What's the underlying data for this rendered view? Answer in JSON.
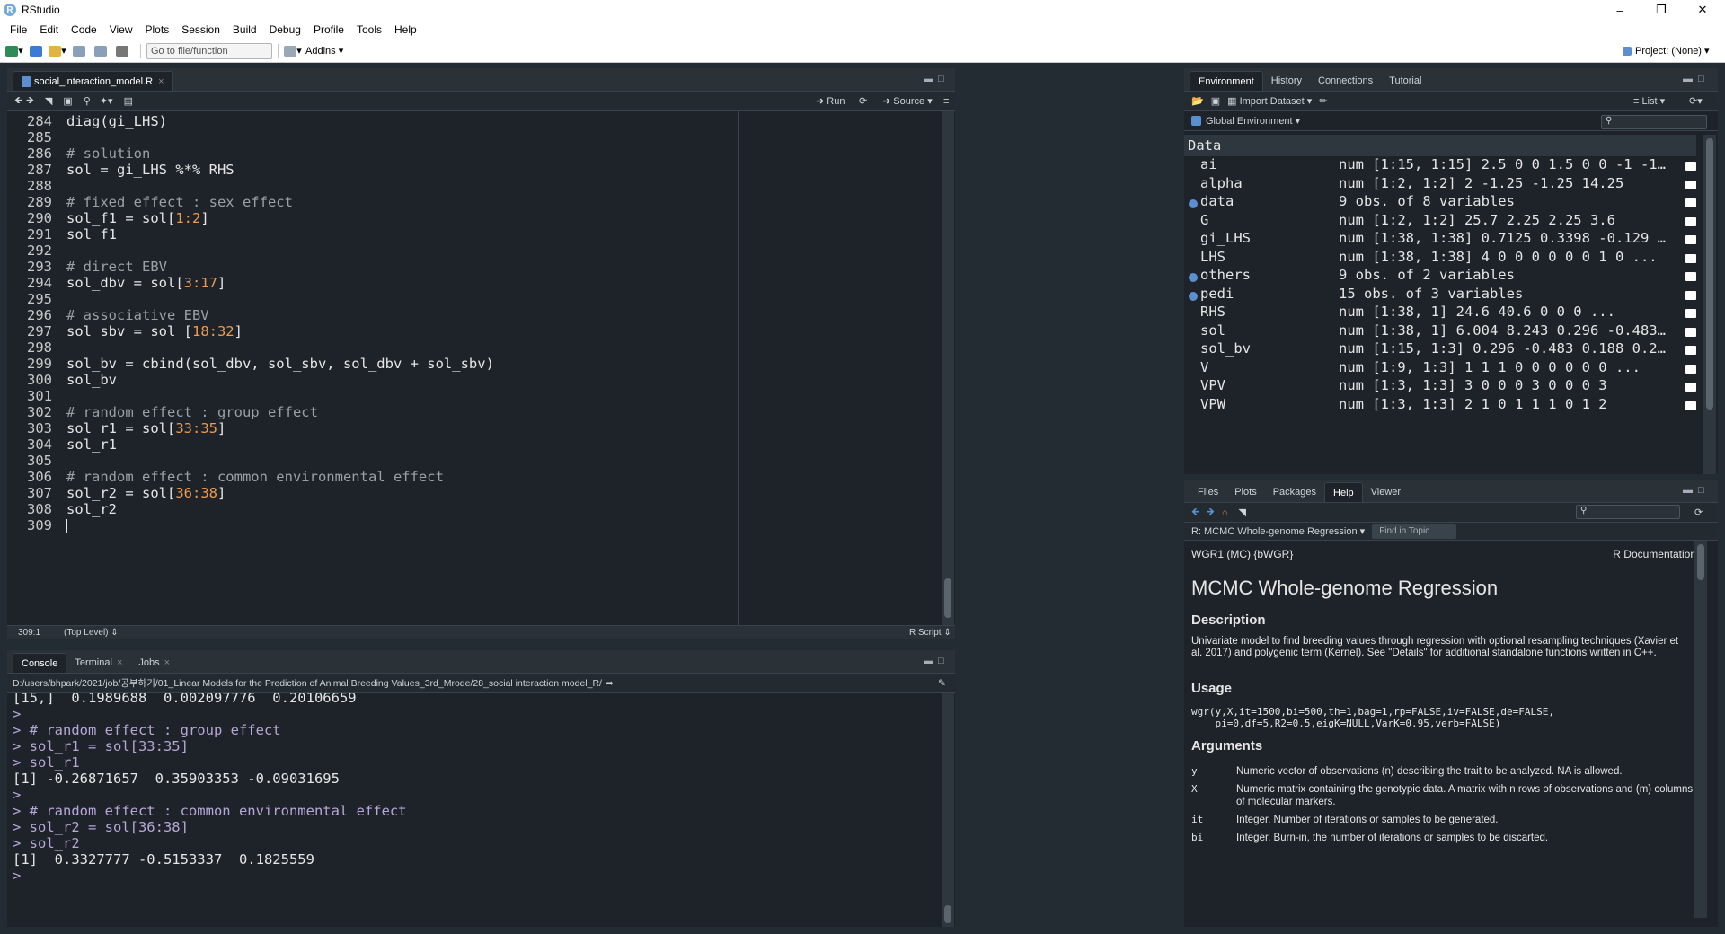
{
  "window": {
    "title": "RStudio"
  },
  "menu": [
    "File",
    "Edit",
    "Code",
    "View",
    "Plots",
    "Session",
    "Build",
    "Debug",
    "Profile",
    "Tools",
    "Help"
  ],
  "toolbar": {
    "goto_placeholder": "Go to file/function",
    "addins": "Addins",
    "project": "Project: (None)"
  },
  "editor": {
    "tab": "social_interaction_model.R",
    "run": "Run",
    "source": "Source",
    "lines": [
      {
        "n": "284",
        "segments": [
          {
            "t": "diag(gi_LHS)",
            "c": "code"
          }
        ]
      },
      {
        "n": "285",
        "segments": []
      },
      {
        "n": "286",
        "segments": [
          {
            "t": "# solution",
            "c": "comment"
          }
        ]
      },
      {
        "n": "287",
        "segments": [
          {
            "t": "sol = gi_LHS %*% RHS",
            "c": "code"
          }
        ]
      },
      {
        "n": "288",
        "segments": []
      },
      {
        "n": "289",
        "segments": [
          {
            "t": "# fixed effect : sex effect",
            "c": "comment"
          }
        ]
      },
      {
        "n": "290",
        "segments": [
          {
            "t": "sol_f1 = sol[",
            "c": "code"
          },
          {
            "t": "1:2",
            "c": "num"
          },
          {
            "t": "]",
            "c": "code"
          }
        ]
      },
      {
        "n": "291",
        "segments": [
          {
            "t": "sol_f1",
            "c": "code"
          }
        ]
      },
      {
        "n": "292",
        "segments": []
      },
      {
        "n": "293",
        "segments": [
          {
            "t": "# direct EBV",
            "c": "comment"
          }
        ]
      },
      {
        "n": "294",
        "segments": [
          {
            "t": "sol_dbv = sol[",
            "c": "code"
          },
          {
            "t": "3:17",
            "c": "num"
          },
          {
            "t": "]",
            "c": "code"
          }
        ]
      },
      {
        "n": "295",
        "segments": []
      },
      {
        "n": "296",
        "segments": [
          {
            "t": "# associative EBV",
            "c": "comment"
          }
        ]
      },
      {
        "n": "297",
        "segments": [
          {
            "t": "sol_sbv = sol [",
            "c": "code"
          },
          {
            "t": "18:32",
            "c": "num"
          },
          {
            "t": "]",
            "c": "code"
          }
        ]
      },
      {
        "n": "298",
        "segments": []
      },
      {
        "n": "299",
        "segments": [
          {
            "t": "sol_bv = cbind(sol_dbv, sol_sbv, sol_dbv + sol_sbv)",
            "c": "code"
          }
        ]
      },
      {
        "n": "300",
        "segments": [
          {
            "t": "sol_bv",
            "c": "code"
          }
        ]
      },
      {
        "n": "301",
        "segments": []
      },
      {
        "n": "302",
        "segments": [
          {
            "t": "# random effect : group effect",
            "c": "comment"
          }
        ]
      },
      {
        "n": "303",
        "segments": [
          {
            "t": "sol_r1 = sol[",
            "c": "code"
          },
          {
            "t": "33:35",
            "c": "num"
          },
          {
            "t": "]",
            "c": "code"
          }
        ]
      },
      {
        "n": "304",
        "segments": [
          {
            "t": "sol_r1",
            "c": "code"
          }
        ]
      },
      {
        "n": "305",
        "segments": []
      },
      {
        "n": "306",
        "segments": [
          {
            "t": "# random effect : common environmental effect",
            "c": "comment"
          }
        ]
      },
      {
        "n": "307",
        "segments": [
          {
            "t": "sol_r2 = sol[",
            "c": "code"
          },
          {
            "t": "36:38",
            "c": "num"
          },
          {
            "t": "]",
            "c": "code"
          }
        ]
      },
      {
        "n": "308",
        "segments": [
          {
            "t": "sol_r2",
            "c": "code"
          }
        ]
      },
      {
        "n": "309",
        "segments": []
      }
    ],
    "status_pos": "309:1",
    "status_scope": "(Top Level)",
    "status_type": "R Script"
  },
  "console": {
    "tabs": [
      "Console",
      "Terminal",
      "Jobs"
    ],
    "path": "D:/users/bhpark/2021/job/공부하기/01_Linear Models for the Prediction of Animal Breeding Values_3rd_Mrode/28_social interaction model_R/",
    "lines": [
      {
        "t": "[15,]  0.1989688  0.002097776  0.20106659",
        "c": "out"
      },
      {
        "t": ">",
        "c": "prompt"
      },
      {
        "t": "> # random effect : group effect",
        "c": "prompt"
      },
      {
        "t": "> sol_r1 = sol[33:35]",
        "c": "prompt"
      },
      {
        "t": "> sol_r1",
        "c": "prompt"
      },
      {
        "t": "[1] -0.26871657  0.35903353 -0.09031695",
        "c": "out"
      },
      {
        "t": ">",
        "c": "prompt"
      },
      {
        "t": "> # random effect : common environmental effect",
        "c": "prompt"
      },
      {
        "t": "> sol_r2 = sol[36:38]",
        "c": "prompt"
      },
      {
        "t": "> sol_r2",
        "c": "prompt"
      },
      {
        "t": "[1]  0.3327777 -0.5153337  0.1825559",
        "c": "out"
      },
      {
        "t": "> ",
        "c": "prompt"
      }
    ]
  },
  "environment": {
    "tabs": [
      "Environment",
      "History",
      "Connections",
      "Tutorial"
    ],
    "import_dataset": "Import Dataset",
    "list": "List",
    "scope": "Global Environment",
    "section": "Data",
    "rows": [
      {
        "name": "ai",
        "value": "num [1:15, 1:15] 2.5 0 0 1.5 0 0 -1 -1 0...",
        "expand": false
      },
      {
        "name": "alpha",
        "value": "num [1:2, 1:2] 2 -1.25 -1.25 14.25",
        "expand": false
      },
      {
        "name": "data",
        "value": "9 obs. of 8 variables",
        "expand": true
      },
      {
        "name": "G",
        "value": "num [1:2, 1:2] 25.7 2.25 2.25 3.6",
        "expand": false
      },
      {
        "name": "gi_LHS",
        "value": "num [1:38, 1:38] 0.7125 0.3398 -0.129 -0...",
        "expand": false
      },
      {
        "name": "LHS",
        "value": "num [1:38, 1:38] 4 0 0 0 0 0 0 1 0 ...",
        "expand": false
      },
      {
        "name": "others",
        "value": "9 obs. of 2 variables",
        "expand": true
      },
      {
        "name": "pedi",
        "value": "15 obs. of 3 variables",
        "expand": true
      },
      {
        "name": "RHS",
        "value": "num [1:38, 1] 24.6 40.6 0 0 0 ...",
        "expand": false
      },
      {
        "name": "sol",
        "value": "num [1:38, 1] 6.004 8.243 0.296 -0.483 0...",
        "expand": false
      },
      {
        "name": "sol_bv",
        "value": "num [1:15, 1:3] 0.296 -0.483 0.188 0.296...",
        "expand": false
      },
      {
        "name": "V",
        "value": "num [1:9, 1:3] 1 1 1 0 0 0 0 0 0 ...",
        "expand": false
      },
      {
        "name": "VPV",
        "value": "num [1:3, 1:3] 3 0 0 0 3 0 0 0 3",
        "expand": false
      },
      {
        "name": "VPW",
        "value": "num [1:3, 1:3] 2 1 0 1 1 1 0 1 2",
        "expand": false
      }
    ]
  },
  "help": {
    "tabs": [
      "Files",
      "Plots",
      "Packages",
      "Help",
      "Viewer"
    ],
    "topic": "R: MCMC Whole-genome Regression",
    "find_in_topic": "Find in Topic",
    "header_left": "WGR1 (MC) {bWGR}",
    "header_right": "R Documentation",
    "title": "MCMC Whole-genome Regression",
    "description_heading": "Description",
    "description": "Univariate model to find breeding values through regression with optional resampling techniques (Xavier et al. 2017) and polygenic term (Kernel). See \"Details\" for additional standalone functions written in C++.",
    "usage_heading": "Usage",
    "usage_line1": "wgr(y,X,it=1500,bi=500,th=1,bag=1,rp=FALSE,iv=FALSE,de=FALSE,",
    "usage_line2": "    pi=0,df=5,R2=0.5,eigK=NULL,VarK=0.95,verb=FALSE)",
    "arguments_heading": "Arguments",
    "args": [
      {
        "name": "y",
        "desc": "Numeric vector of observations (n) describing the trait to be analyzed. NA is allowed."
      },
      {
        "name": "X",
        "desc": "Numeric matrix containing the genotypic data. A matrix with n rows of observations and (m) columns of molecular markers."
      },
      {
        "name": "it",
        "desc": "Integer. Number of iterations or samples to be generated."
      },
      {
        "name": "bi",
        "desc": "Integer. Burn-in, the number of iterations or samples to be discarted."
      }
    ]
  },
  "colors": {
    "bg": "#1d2328",
    "comment": "#9aa0a6",
    "number": "#ef9a52",
    "prompt": "#b7a6d8",
    "accent": "#5b8fd1"
  }
}
